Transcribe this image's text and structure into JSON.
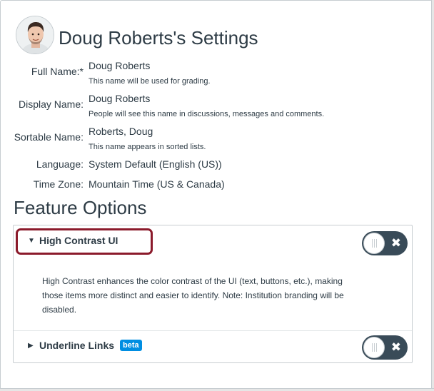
{
  "header": {
    "title": "Doug Roberts's Settings"
  },
  "fields": [
    {
      "label": "Full Name:*",
      "value": "Doug Roberts",
      "help": "This name will be used for grading."
    },
    {
      "label": "Display Name:",
      "value": "Doug Roberts",
      "help": "People will see this name in discussions, messages and comments."
    },
    {
      "label": "Sortable Name:",
      "value": "Roberts, Doug",
      "help": "This name appears in sorted lists."
    },
    {
      "label": "Language:",
      "value": "System Default (English (US))"
    },
    {
      "label": "Time Zone:",
      "value": "Mountain Time (US & Canada)"
    }
  ],
  "features": {
    "title": "Feature Options",
    "items": [
      {
        "name": "High Contrast UI",
        "expanded": true,
        "enabled": false,
        "description": "High Contrast enhances the color contrast of the UI (text, buttons, etc.), making those items more distinct and easier to identify. Note: Institution branding will be disabled."
      },
      {
        "name": "Underline Links",
        "badge": "beta",
        "expanded": false,
        "enabled": false
      }
    ]
  },
  "icons": {
    "expanded_caret": "caret-down-icon",
    "collapsed_caret": "caret-right-icon",
    "toggle_off": "close-icon",
    "grip": "grip-icon"
  },
  "colors": {
    "text": "#2d3b45",
    "toggle_bg": "#394b58",
    "highlight": "#8b1a2b",
    "beta_badge": "#008ee2"
  }
}
